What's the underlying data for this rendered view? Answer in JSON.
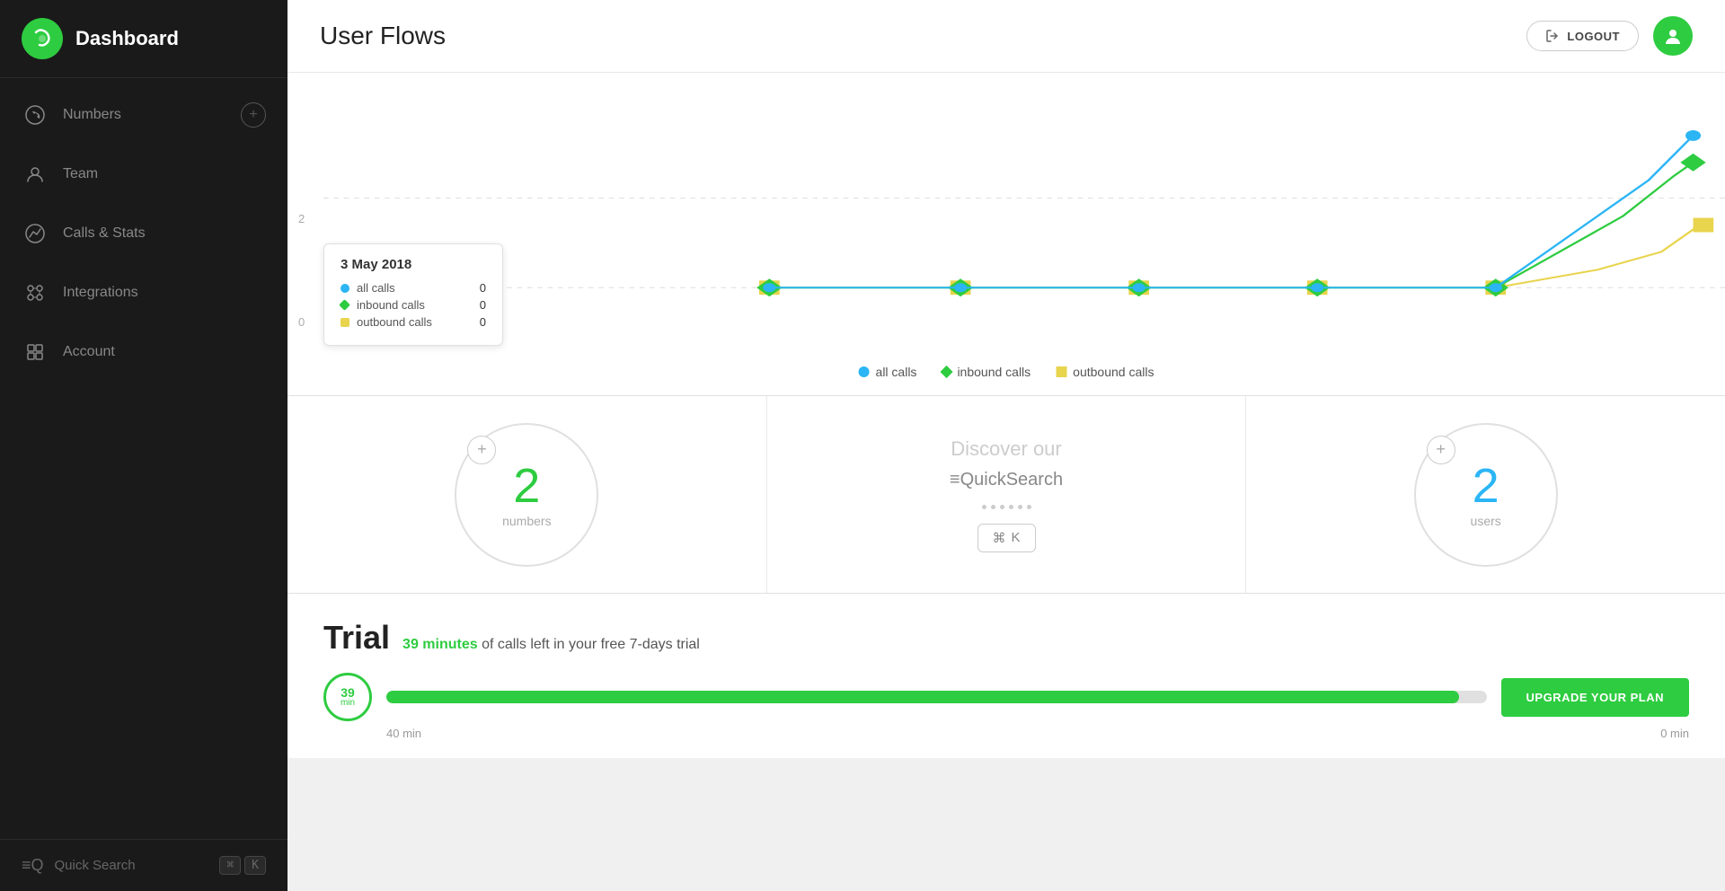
{
  "sidebar": {
    "logo_icon": "📞",
    "title": "Dashboard",
    "nav_items": [
      {
        "id": "numbers",
        "label": "Numbers",
        "icon": "phone",
        "has_plus": true
      },
      {
        "id": "team",
        "label": "Team",
        "icon": "person",
        "has_plus": false
      },
      {
        "id": "calls-stats",
        "label": "Calls & Stats",
        "icon": "chart",
        "has_plus": false
      },
      {
        "id": "integrations",
        "label": "Integrations",
        "icon": "integrations",
        "has_plus": false
      },
      {
        "id": "account",
        "label": "Account",
        "icon": "grid",
        "has_plus": false
      }
    ],
    "quick_search_label": "Quick Search",
    "kbd1": "⌘",
    "kbd2": "K"
  },
  "topbar": {
    "page_title": "User Flows",
    "logout_label": "LOGOUT",
    "logout_icon": "logout"
  },
  "chart": {
    "tooltip": {
      "date": "3 May 2018",
      "rows": [
        {
          "label": "all calls",
          "value": "0",
          "color": "#2bb5f5",
          "shape": "circle"
        },
        {
          "label": "inbound calls",
          "value": "0",
          "color": "#2ecc40",
          "shape": "diamond"
        },
        {
          "label": "outbound calls",
          "value": "0",
          "color": "#e8d44d",
          "shape": "square"
        }
      ]
    },
    "y_labels": [
      "2",
      "0"
    ],
    "legend": [
      {
        "label": "all calls",
        "color": "#2bb5f5",
        "shape": "circle"
      },
      {
        "label": "inbound calls",
        "color": "#2ecc40",
        "shape": "diamond"
      },
      {
        "label": "outbound calls",
        "color": "#e8d44d",
        "shape": "square"
      }
    ]
  },
  "widgets": [
    {
      "number": "2",
      "label": "numbers",
      "has_plus": true,
      "color": "#2ecc40"
    },
    {
      "type": "discover",
      "discover_text": "Discover our",
      "qs_text": "≡QuickSearch",
      "kbd1": "⌘",
      "kbd2": "K"
    },
    {
      "number": "2",
      "label": "users",
      "has_plus": true,
      "color": "#2bb5f5"
    }
  ],
  "trial": {
    "title": "Trial",
    "minutes_colored": "39 minutes",
    "description": "of calls left in your free 7-days trial",
    "circle_number": "39",
    "circle_unit": "min",
    "bar_fill_percent": 97.5,
    "label_left": "40 min",
    "label_right": "0 min",
    "upgrade_btn_label": "UPGRADE YOUR PLAN"
  }
}
